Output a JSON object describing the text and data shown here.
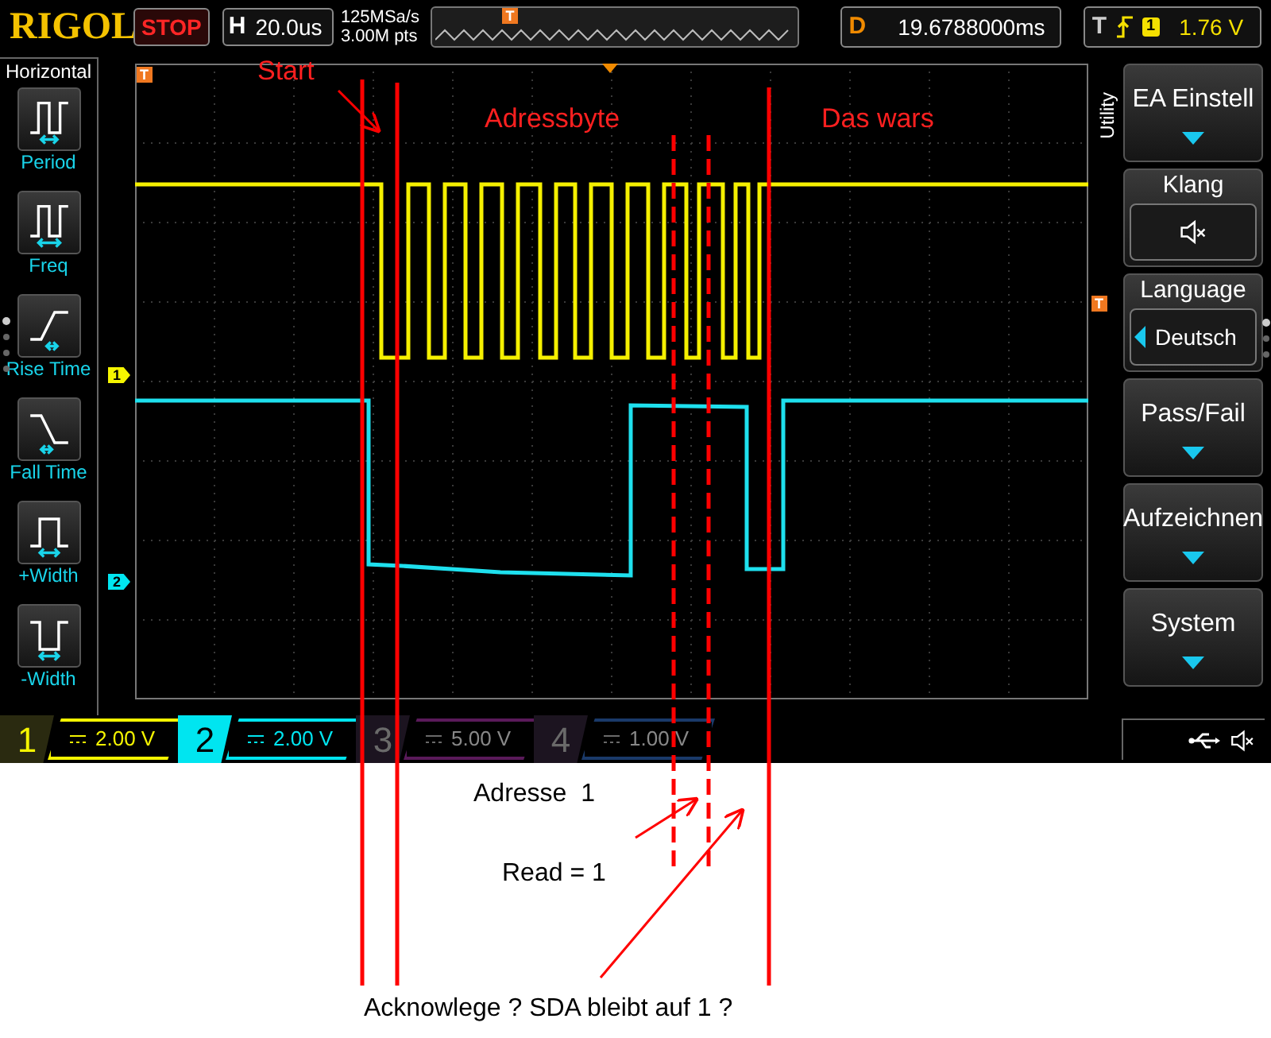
{
  "brand": "RIGOL",
  "run_state": "STOP",
  "horizontal": {
    "label": "H",
    "timebase": "20.0us",
    "sample_rate": "125MSa/s",
    "memory_depth": "3.00M pts",
    "position_marker": "T"
  },
  "delay": {
    "label": "D",
    "value": "19.6788000ms"
  },
  "trigger": {
    "label": "T",
    "channel": "1",
    "level": "1.76 V"
  },
  "left_menu": {
    "title": "Horizontal",
    "items": [
      {
        "kind": "period",
        "label": "Period"
      },
      {
        "kind": "freq",
        "label": "Freq"
      },
      {
        "kind": "rise_time",
        "label": "Rise Time"
      },
      {
        "kind": "fall_time",
        "label": "Fall Time"
      },
      {
        "kind": "pos_width",
        "label": "+Width"
      },
      {
        "kind": "neg_width",
        "label": "-Width"
      }
    ]
  },
  "right_menu": {
    "title": "Utility",
    "items": [
      {
        "kind": "submenu",
        "label": "EA Einstell"
      },
      {
        "kind": "sound",
        "label": "Klang",
        "muted": true
      },
      {
        "kind": "option",
        "label": "Language",
        "value": "Deutsch"
      },
      {
        "kind": "submenu",
        "label": "Pass/Fail"
      },
      {
        "kind": "submenu",
        "label": "Aufzeichnen"
      },
      {
        "kind": "submenu",
        "label": "System"
      }
    ]
  },
  "waveform_area": {
    "trigger_markers": [
      "T",
      "T"
    ],
    "labels": [
      "Start",
      "Adressbyte",
      "Das wars"
    ]
  },
  "channels": [
    {
      "number": "1",
      "marker": "1",
      "scale": "2.00 V",
      "on": true,
      "selected": false,
      "color": "#f5f500"
    },
    {
      "number": "2",
      "marker": "2",
      "scale": "2.00 V",
      "on": true,
      "selected": true,
      "color": "#00e5f0"
    },
    {
      "number": "3",
      "scale": "5.00 V",
      "on": false,
      "selected": false,
      "color": "#5a1a5a"
    },
    {
      "number": "4",
      "scale": "1.00 V",
      "on": false,
      "selected": false,
      "color": "#1a3a6a"
    }
  ],
  "notes": [
    "Adresse  1",
    "Read = 1",
    "Acknowlege ? SDA bleibt auf 1 ?"
  ]
}
